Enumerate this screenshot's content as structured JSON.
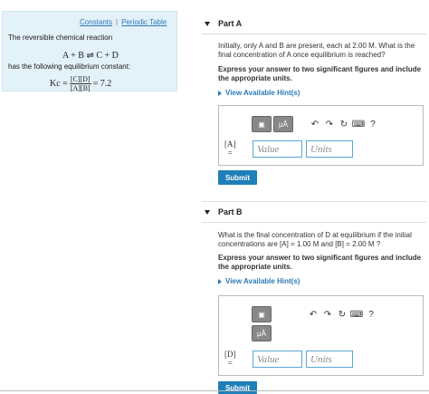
{
  "left_panel": {
    "links": [
      "Constants",
      "Periodic Table"
    ],
    "separator": "|",
    "line1": "The reversible chemical reaction",
    "equation": "A + B ⇌ C + D",
    "line2": "has the following equilibrium constant:",
    "kc_lhs": "Kc =",
    "kc_num": "[C][D]",
    "kc_den": "[A][B]",
    "kc_rhs": "= 7.2"
  },
  "part_a": {
    "title": "Part A",
    "question": "Initially, only A and B are present, each at 2.00 M. What is the final concentration of A once equilibrium is reached?",
    "instructions": "Express your answer to two significant figures and include the appropriate units.",
    "hint": "View Available Hint(s)",
    "var_label": "[A]",
    "eq_sign": "=",
    "value_placeholder": "Value",
    "units_placeholder": "Units",
    "submit": "Submit"
  },
  "part_b": {
    "title": "Part B",
    "question": "What is the final concentration of D at equilibrium if the initial concentrations are [A] = 1.00 M and [B] = 2.00 M ?",
    "instructions": "Express your answer to two significant figures and include the appropriate units.",
    "hint": "View Available Hint(s)",
    "var_label": "[D]",
    "eq_sign": "=",
    "value_placeholder": "Value",
    "units_placeholder": "Units",
    "submit": "Submit"
  },
  "toolbar": {
    "mu_label": "μÅ",
    "help_label": "?"
  }
}
